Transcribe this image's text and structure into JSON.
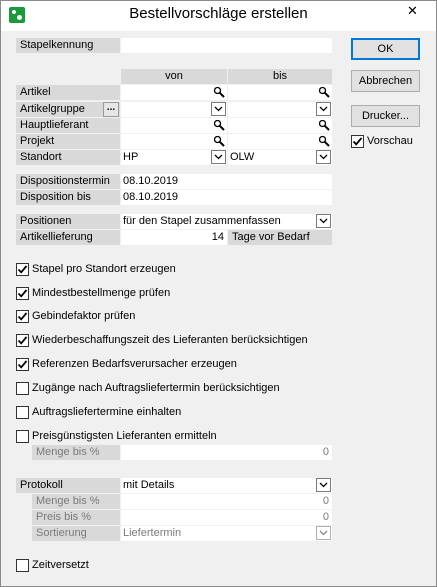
{
  "window": {
    "title": "Bestellvorschläge erstellen",
    "close_glyph": "✕"
  },
  "buttons": {
    "ok": "OK",
    "cancel": "Abbrechen",
    "printer": "Drucker..."
  },
  "vorschau": {
    "label": "Vorschau",
    "checked": true
  },
  "stapelkennung": {
    "label": "Stapelkennung",
    "value": ""
  },
  "range_headers": {
    "from": "von",
    "to": "bis"
  },
  "range_rows": [
    {
      "label": "Artikel",
      "from": "",
      "to": ""
    },
    {
      "label": "Artikelgruppe",
      "from": "",
      "to": ""
    },
    {
      "label": "Hauptlieferant",
      "from": "",
      "to": ""
    },
    {
      "label": "Projekt",
      "from": "",
      "to": ""
    },
    {
      "label": "Standort",
      "from": "HP",
      "to": "OLW"
    }
  ],
  "artikelgruppe_button": "...",
  "dispositionstermin": {
    "label": "Dispositionstermin",
    "value": "08.10.2019"
  },
  "disposition_bis": {
    "label": "Disposition bis",
    "value": "08.10.2019"
  },
  "positionen": {
    "label": "Positionen",
    "value": "für den Stapel zusammenfassen"
  },
  "artikellieferung": {
    "label": "Artikellieferung",
    "value": "14",
    "suffix": "Tage vor Bedarf"
  },
  "options": [
    {
      "label": "Stapel pro Standort erzeugen",
      "checked": true
    },
    {
      "label": "Mindestbestellmenge prüfen",
      "checked": true
    },
    {
      "label": "Gebindefaktor prüfen",
      "checked": true
    },
    {
      "label": "Wiederbeschaffungszeit des Lieferanten berücksichtigen",
      "checked": true
    },
    {
      "label": "Referenzen Bedarfsverursacher erzeugen",
      "checked": true
    },
    {
      "label": "Zugänge nach Auftragsliefertermin berücksichtigen",
      "checked": false
    },
    {
      "label": "Auftragsliefertermine einhalten",
      "checked": false
    },
    {
      "label": "Preisgünstigsten Lieferanten ermitteln",
      "checked": false
    }
  ],
  "menge_bis_1": {
    "label": "Menge bis %",
    "value": "0"
  },
  "protokoll": {
    "label": "Protokoll",
    "value": "mit Details"
  },
  "menge_bis_2": {
    "label": "Menge bis %",
    "value": "0"
  },
  "preis_bis": {
    "label": "Preis bis %",
    "value": "0"
  },
  "sortierung": {
    "label": "Sortierung",
    "value": "Liefertermin"
  },
  "zeitversetzt": {
    "label": "Zeitversetzt",
    "checked": false
  }
}
